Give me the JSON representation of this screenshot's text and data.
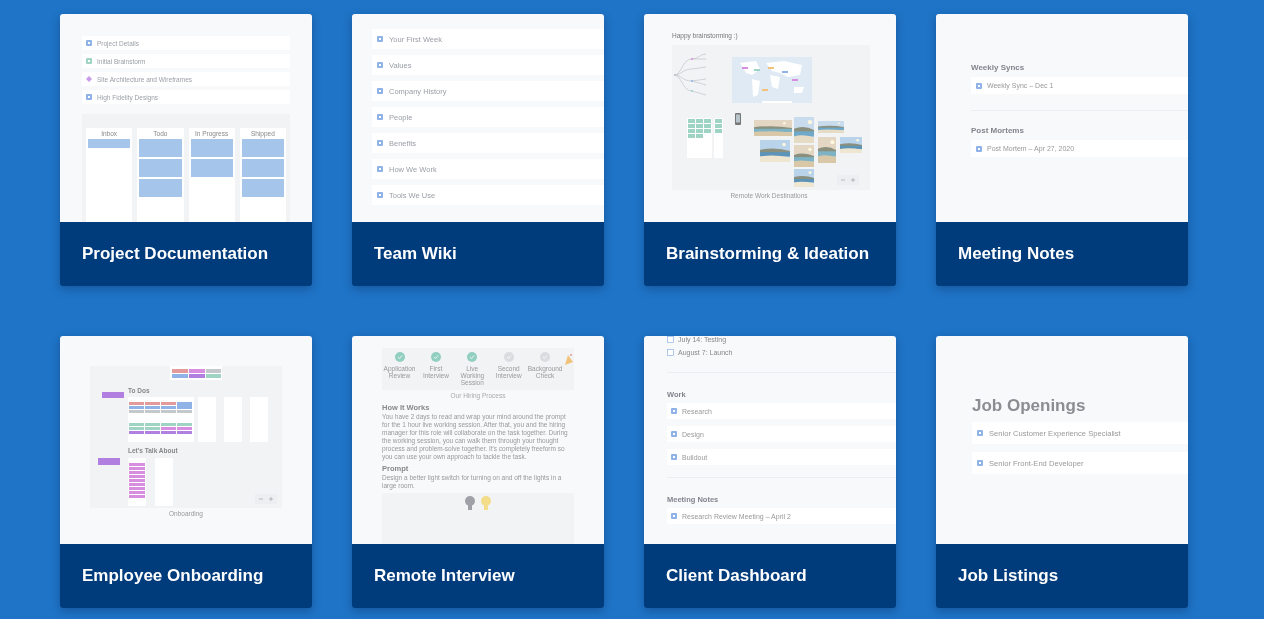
{
  "cards": [
    {
      "title": "Project Documentation",
      "preview": {
        "kind": "project",
        "pages": [
          {
            "label": "Project Details",
            "color": "#8fb3e6",
            "kind": "page"
          },
          {
            "label": "Initial Brainstorm",
            "color": "#9fd3c4",
            "kind": "page"
          },
          {
            "label": "Site Architecture and Wireframes",
            "color": "#c79be8",
            "kind": "board"
          },
          {
            "label": "High Fidelity Designs",
            "color": "#8fb3e6",
            "kind": "page"
          }
        ],
        "board_columns": [
          "Inbox",
          "Todo",
          "In Progress",
          "Shipped"
        ]
      }
    },
    {
      "title": "Team Wiki",
      "preview": {
        "kind": "wiki",
        "pages": [
          "Your First Week",
          "Values",
          "Company History",
          "People",
          "Benefits",
          "How We Work",
          "Tools We Use"
        ]
      }
    },
    {
      "title": "Brainstorming & Ideation",
      "preview": {
        "kind": "brainstorm",
        "heading": "Happy brainstorming :)",
        "caption": "Remote Work Destinations"
      }
    },
    {
      "title": "Meeting Notes",
      "preview": {
        "kind": "sections",
        "sections": [
          {
            "heading": "Weekly Syncs",
            "items": [
              "Weekly Sync – Dec 1"
            ]
          },
          {
            "heading": "Post Mortems",
            "items": [
              "Post Mortem – Apr 27, 2020"
            ]
          }
        ]
      }
    },
    {
      "title": "Employee Onboarding",
      "preview": {
        "kind": "onboarding",
        "headings": [
          "To Dos",
          "Let's Talk About"
        ],
        "caption": "Onboarding"
      }
    },
    {
      "title": "Remote Interview",
      "preview": {
        "kind": "interview",
        "steps": [
          {
            "label": "Application Review",
            "done": true
          },
          {
            "label": "First Interview",
            "done": true
          },
          {
            "label": "Live Working Session",
            "done": true
          },
          {
            "label": "Second Interview",
            "done": false
          },
          {
            "label": "Background Check",
            "done": false
          }
        ],
        "caption": "Our Hiring Process",
        "sections": [
          {
            "heading": "How It Works",
            "body": "You have 2 days to read and wrap your mind around the prompt for the 1 hour live working session. After that, you and the hiring manager for this role will collaborate on the task together. During the working session, you can walk them through your thought process and problem-solve together. It's completely freeform so you can use your own approach to tackle the task."
          },
          {
            "heading": "Prompt",
            "body": "Design a better light switch for turning on and off the lights in a large room."
          }
        ]
      }
    },
    {
      "title": "Client Dashboard",
      "preview": {
        "kind": "dashboard",
        "tasks": [
          {
            "label": "July 14: Testing",
            "checked": false
          },
          {
            "label": "August 7: Launch",
            "checked": false
          }
        ],
        "sections": [
          {
            "heading": "Work",
            "items": [
              "Research",
              "Design",
              "Buildout"
            ]
          },
          {
            "heading": "Meeting Notes",
            "items": [
              "Research Review Meeting – April 2"
            ]
          }
        ]
      }
    },
    {
      "title": "Job Listings",
      "preview": {
        "kind": "jobs",
        "heading": "Job Openings",
        "items": [
          "Senior Customer Experience Specialist",
          "Senior Front-End Developer"
        ]
      }
    }
  ]
}
